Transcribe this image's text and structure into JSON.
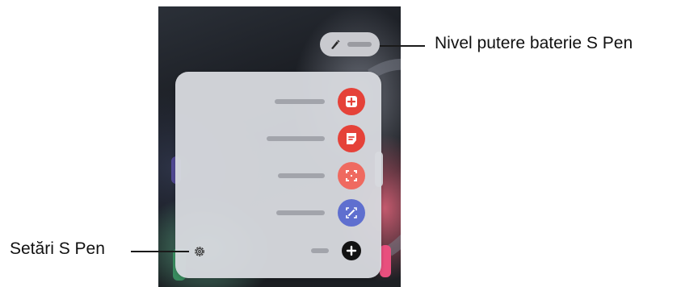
{
  "callouts": {
    "battery": "Nivel putere baterie S Pen",
    "settings": "Setări S Pen"
  },
  "air_command": {
    "items": [
      {
        "icon": "create-note-icon",
        "color": "#e54239"
      },
      {
        "icon": "view-all-notes-icon",
        "color": "#e54239"
      },
      {
        "icon": "smart-select-icon",
        "color": "#ef6a60"
      },
      {
        "icon": "screen-write-icon",
        "color": "#5f6fcf"
      },
      {
        "icon": "add-icon",
        "color": "#121212"
      }
    ],
    "settings_icon": "gear-icon"
  },
  "battery_indicator": {
    "icon": "s-pen-icon"
  }
}
